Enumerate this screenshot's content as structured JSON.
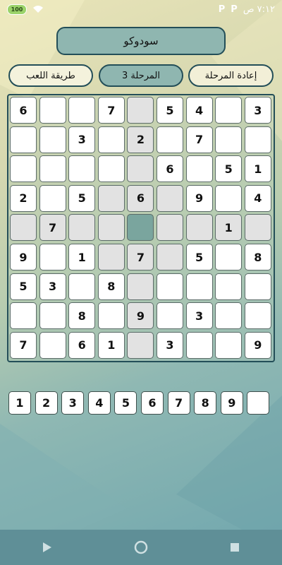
{
  "status_bar": {
    "time": "٧:١٢ ص",
    "notification_badges": [
      "P",
      "P"
    ],
    "battery_level": "100"
  },
  "header": {
    "title": "سودوكو"
  },
  "toolbar": {
    "how_to_play_label": "طريقة اللعب",
    "level_label": "المرحلة 3",
    "restart_label": "إعادة المرحلة"
  },
  "board": {
    "rows": [
      [
        "6",
        "",
        "",
        "7",
        "",
        "5",
        "4",
        "",
        "3"
      ],
      [
        "",
        "",
        "3",
        "",
        "2",
        "",
        "7",
        "",
        ""
      ],
      [
        "",
        "",
        "",
        "",
        "",
        "6",
        "",
        "5",
        "1"
      ],
      [
        "2",
        "",
        "5",
        "",
        "6",
        "",
        "9",
        "",
        "4"
      ],
      [
        "",
        "7",
        "",
        "",
        "",
        "",
        "",
        "1",
        ""
      ],
      [
        "9",
        "",
        "1",
        "",
        "7",
        "",
        "5",
        "",
        "8"
      ],
      [
        "5",
        "3",
        "",
        "8",
        "",
        "",
        "",
        "",
        ""
      ],
      [
        "",
        "",
        "8",
        "",
        "9",
        "",
        "3",
        "",
        ""
      ],
      [
        "7",
        "",
        "6",
        "1",
        "",
        "3",
        "",
        "",
        "9"
      ]
    ],
    "selected_cell": {
      "row": 4,
      "col": 4
    }
  },
  "numpad": {
    "keys": [
      "1",
      "2",
      "3",
      "4",
      "5",
      "6",
      "7",
      "8",
      "9",
      ""
    ]
  },
  "navbar": {
    "back_icon": "triangle-back-icon",
    "home_icon": "circle-home-icon",
    "recents_icon": "square-recents-icon"
  }
}
